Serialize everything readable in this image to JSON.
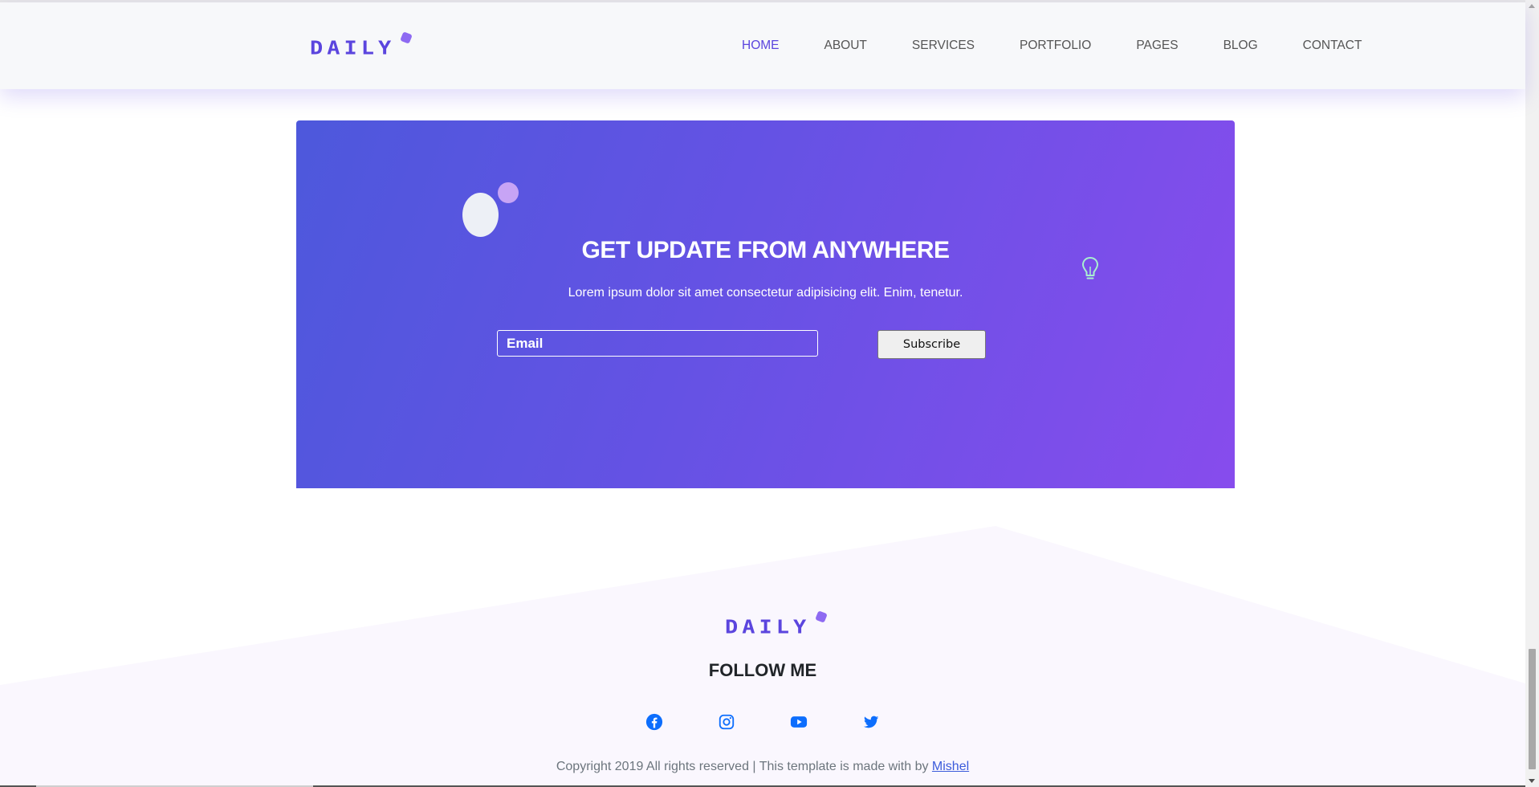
{
  "brand": {
    "logo_text": "DAILY",
    "accent_color": "#5b45de"
  },
  "nav": {
    "items": [
      {
        "label": "HOME",
        "active": true
      },
      {
        "label": "ABOUT",
        "active": false
      },
      {
        "label": "SERVICES",
        "active": false
      },
      {
        "label": "PORTFOLIO",
        "active": false
      },
      {
        "label": "PAGES",
        "active": false
      },
      {
        "label": "BLOG",
        "active": false
      },
      {
        "label": "CONTACT",
        "active": false
      }
    ]
  },
  "subscribe": {
    "title": "GET UPDATE FROM ANYWHERE",
    "subtitle": "Lorem ipsum dolor sit amet consectetur adipisicing elit. Enim, tenetur.",
    "email_placeholder": "Email",
    "button_label": "Subscribe",
    "gradient_start": "#4d58dc",
    "gradient_end": "#874ced",
    "decor_icon": "lightbulb-icon"
  },
  "footer": {
    "logo_text": "DAILY",
    "follow_title": "FOLLOW ME",
    "socials": [
      {
        "name": "facebook-icon"
      },
      {
        "name": "instagram-icon"
      },
      {
        "name": "youtube-icon"
      },
      {
        "name": "twitter-icon"
      }
    ],
    "social_color": "#0d6efd",
    "copyright_text": "Copyright 2019 All rights reserved | This template is made with by ",
    "copyright_link": "Mishel"
  }
}
